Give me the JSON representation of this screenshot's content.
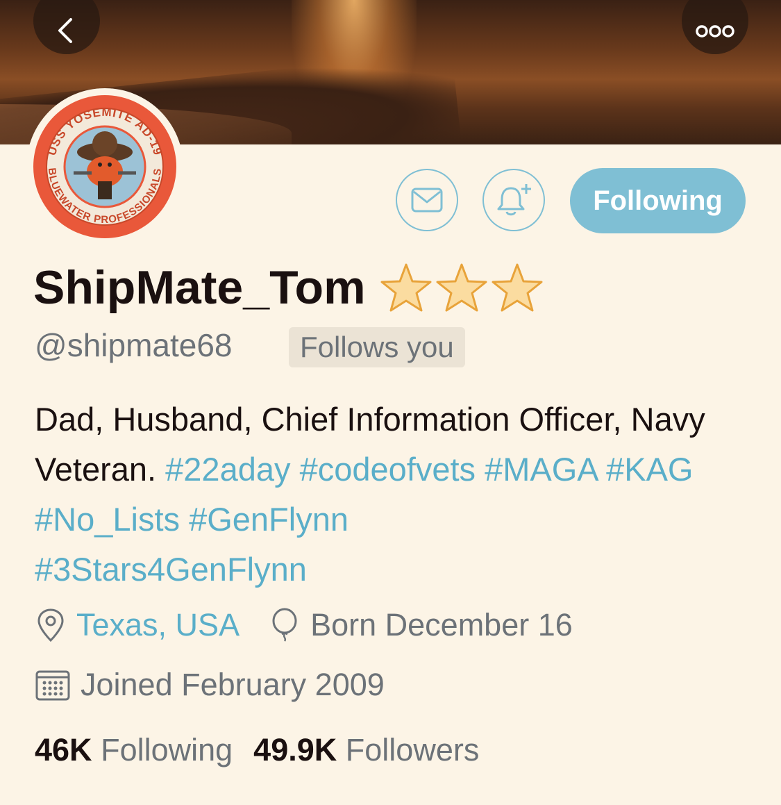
{
  "header": {
    "back_icon": "chevron-left-icon",
    "more_icon": "more-dots-icon"
  },
  "avatar": {
    "top_text": "USS YOSEMITE AD-19",
    "bottom_text": "BLUEWATER PROFESSIONALS"
  },
  "actions": {
    "message_icon": "envelope-icon",
    "notify_icon": "bell-plus-icon",
    "following_label": "Following"
  },
  "profile": {
    "display_name": "ShipMate_Tom",
    "stars_count": 3,
    "handle": "@shipmate68",
    "follows_you": "Follows you",
    "bio_text_1": "Dad, Husband, Chief Information Officer, Navy Veteran.",
    "bio_tags": [
      "#22aday",
      "#codeofvets",
      "#MAGA",
      "#KAG",
      "#No_Lists",
      "#GenFlynn",
      "#3Stars4GenFlynn"
    ],
    "location": "Texas, USA",
    "birthday": "Born December 16",
    "joined": "Joined February 2009"
  },
  "stats": {
    "following_count": "46K",
    "following_label": "Following",
    "followers_count": "49.9K",
    "followers_label": "Followers"
  },
  "colors": {
    "accent": "#7fbfd4",
    "link": "#5aaec9",
    "background": "#fcf4e6"
  }
}
